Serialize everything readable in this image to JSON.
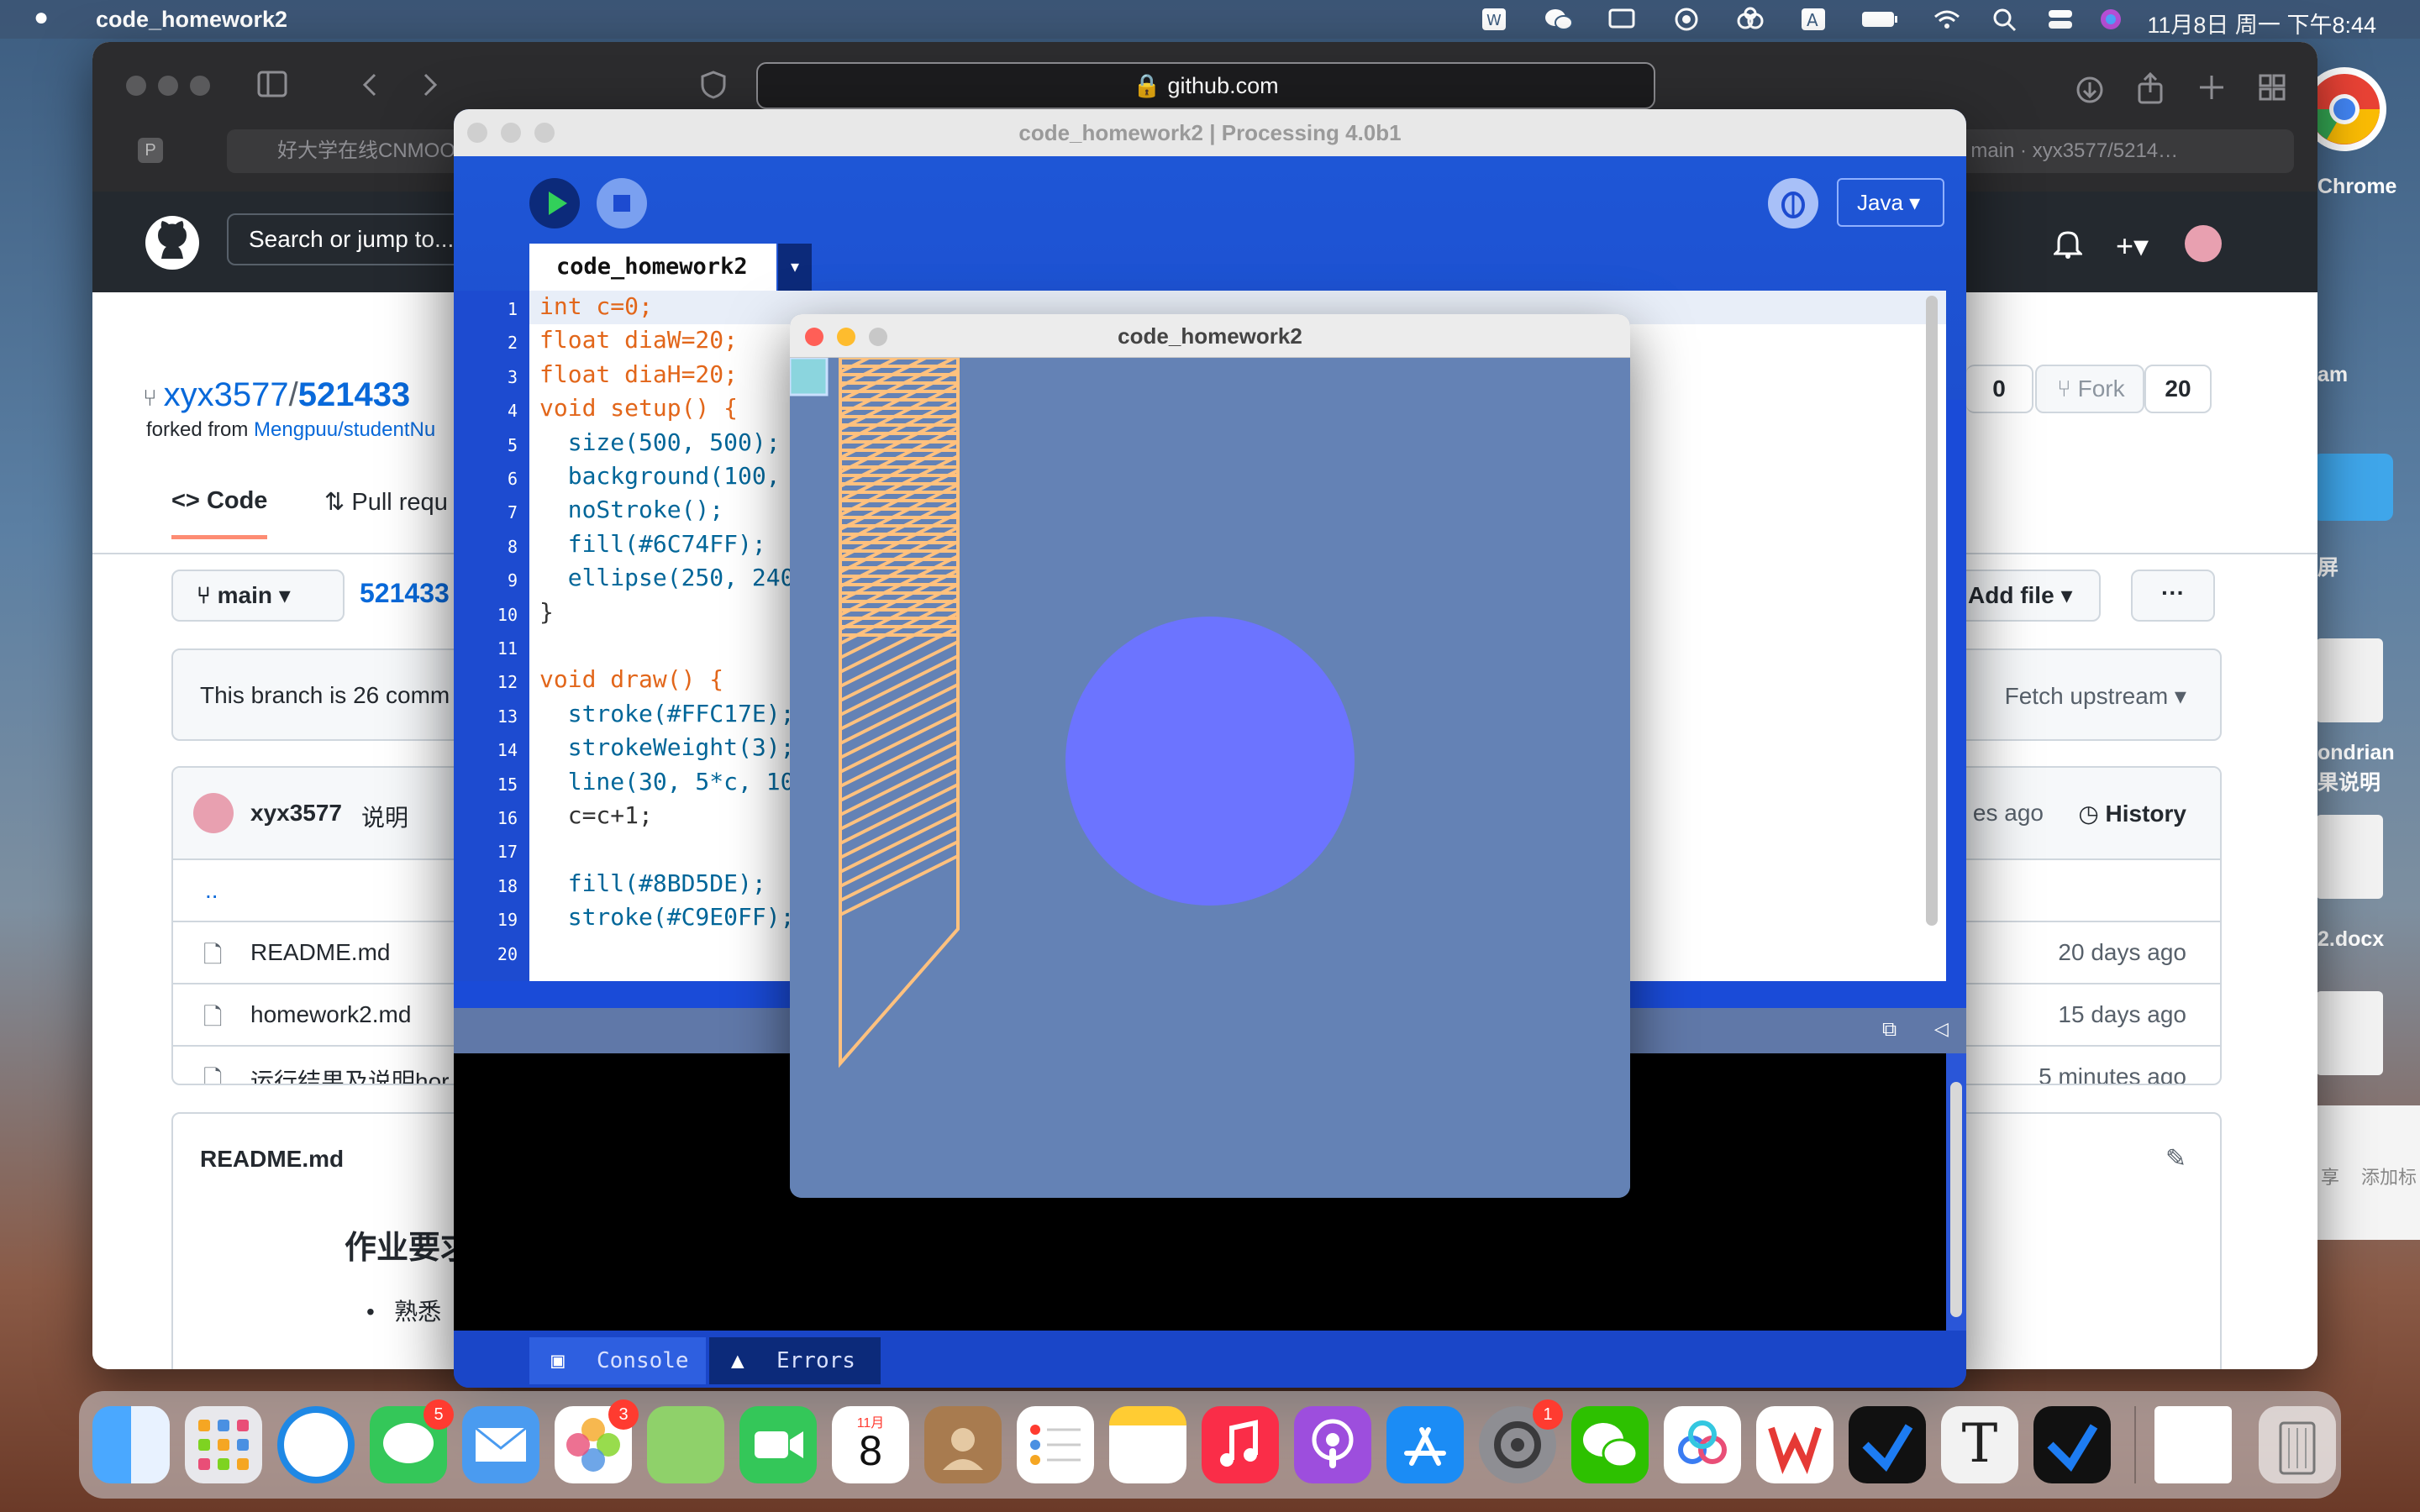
{
  "menubar": {
    "app": "code_homework2",
    "clock": "11月8日 周一 下午8:44"
  },
  "safari": {
    "address": "github.com",
    "tab1": "好大学在线CNMOOC",
    "tab2": "】作业 at main · xyx3577/5214…",
    "gh_search": "Search or jump to...",
    "repo_owner": "xyx3577",
    "repo_sep": "/",
    "repo_name": "521433",
    "forked_prefix": "forked from ",
    "forked_link": "Mengpuu/studentNu",
    "nav_code": "Code",
    "nav_pull": "Pull requ",
    "star_count": "0",
    "fork_label": "Fork",
    "fork_count": "20",
    "branch": "main",
    "path": "521433",
    "add_file": "Add file",
    "more": "···",
    "branch_info": "This branch is 26 comm",
    "fetch_upstream": "Fetch upstream",
    "commit_author": "xyx3577",
    "commit_msg": "说明",
    "commit_time": "es ago",
    "history": "History",
    "parent_dir": "..",
    "files": [
      {
        "name": "README.md",
        "time": "20 days ago"
      },
      {
        "name": "homework2.md",
        "time": "15 days ago"
      },
      {
        "name": "运行结果及说明hor",
        "time": "5 minutes ago"
      }
    ],
    "readme_title": "README.md",
    "readme_heading": "作业要求",
    "readme_bullet": "熟悉"
  },
  "processing": {
    "title": "code_homework2 | Processing 4.0b1",
    "mode": "Java",
    "tab": "code_homework2",
    "lines": [
      {
        "n": "1",
        "t": "int c=0;"
      },
      {
        "n": "2",
        "t": "float diaW=20;"
      },
      {
        "n": "3",
        "t": "float diaH=20;"
      },
      {
        "n": "4",
        "t": "void setup() {"
      },
      {
        "n": "5",
        "t": "  size(500, 500);"
      },
      {
        "n": "6",
        "t": "  background(100, 1"
      },
      {
        "n": "7",
        "t": "  noStroke();"
      },
      {
        "n": "8",
        "t": "  fill(#6C74FF);"
      },
      {
        "n": "9",
        "t": "  ellipse(250, 240,"
      },
      {
        "n": "10",
        "t": "}"
      },
      {
        "n": "11",
        "t": ""
      },
      {
        "n": "12",
        "t": "void draw() {"
      },
      {
        "n": "13",
        "t": "  stroke(#FFC17E);"
      },
      {
        "n": "14",
        "t": "  strokeWeight(3);"
      },
      {
        "n": "15",
        "t": "  line(30, 5*c, 100"
      },
      {
        "n": "16",
        "t": "  c=c+1;"
      },
      {
        "n": "17",
        "t": ""
      },
      {
        "n": "18",
        "t": "  fill(#8BD5DE);"
      },
      {
        "n": "19",
        "t": "  stroke(#C9E0FF);"
      },
      {
        "n": "20",
        "t": ""
      }
    ],
    "console_tab": "Console",
    "errors_tab": "Errors"
  },
  "sketch": {
    "title": "code_homework2",
    "background": "#6482B5",
    "circle": "#6C74FF",
    "lines": "#FFC17E",
    "rect": "#8BD5DE"
  },
  "desktop": {
    "chrome": "Chrome",
    "l1": "am",
    "l2": "屏",
    "l3": "ondrian",
    "l4": "果说明",
    "l5": "2.docx",
    "share": "享",
    "tag": "添加标"
  },
  "dock": {
    "messages_badge": "5",
    "photos_badge": "3",
    "settings_badge": "1",
    "cal_month": "11月",
    "cal_day": "8"
  }
}
